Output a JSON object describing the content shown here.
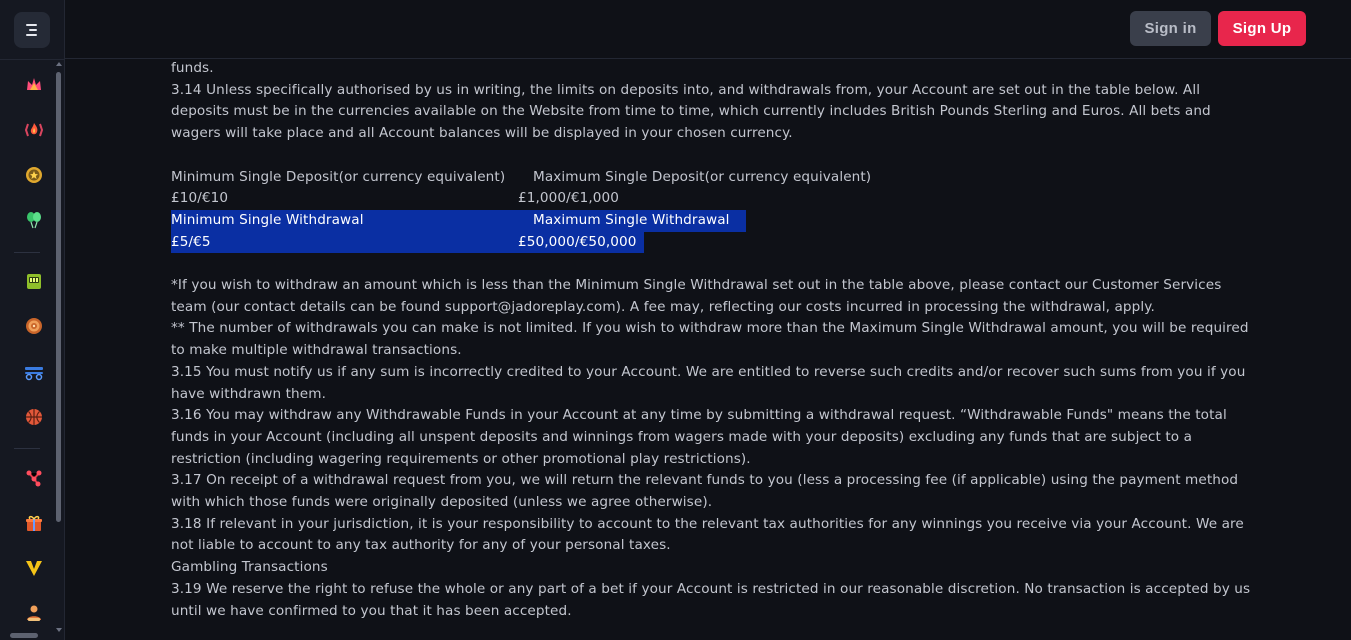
{
  "header": {
    "signin_label": "Sign in",
    "signup_label": "Sign Up",
    "signup_color": "#e8264c"
  },
  "sidebar": {
    "menu_icon": "menu-icon",
    "icons": [
      "flame-crown-icon",
      "fire-badge-icon",
      "star-coin-icon",
      "balloons-icon",
      "slot-machine-icon",
      "target-icon",
      "table-games-icon",
      "basketball-icon",
      "molecule-icon",
      "gift-box-icon",
      "v-logo-icon",
      "users-icon"
    ]
  },
  "content": {
    "line_funds": "funds.",
    "para_314": "3.14 Unless specifically authorised by us in writing, the limits on deposits into, and withdrawals from, your Account are set out in the table below. All deposits must be in the currencies available on the Website from time to time, which currently includes British Pounds Sterling and Euros. All bets and wagers will take place and all Account balances will be displayed in your chosen currency.",
    "table": {
      "min_deposit_label": "Minimum Single Deposit(or currency equivalent)",
      "max_deposit_label": "Maximum Single Deposit(or currency equivalent)",
      "min_deposit_value": "£10/€10",
      "max_deposit_value": "£1,000/€1,000",
      "min_withdrawal_label": "Minimum Single Withdrawal",
      "max_withdrawal_label": "Maximum Single Withdrawal",
      "min_withdrawal_value": "£5/€5",
      "max_withdrawal_value": "£50,000/€50,000"
    },
    "note_1": "*If you wish to withdraw an amount which is less than the Minimum Single Withdrawal set out in the table above, please contact our Customer Services team (our contact details can be found support@jadoreplay.com). A fee may, reflecting our costs incurred in processing the withdrawal, apply.",
    "note_2": "** The number of withdrawals you can make is not limited. If you wish to withdraw more than the Maximum Single Withdrawal amount, you will be required to make multiple withdrawal transactions.",
    "para_315": "3.15 You must notify us if any sum is incorrectly credited to your Account. We are entitled to reverse such credits and/or recover such sums from you if you have withdrawn them.",
    "para_316": "3.16 You may withdraw any Withdrawable Funds in your Account at any time by submitting a withdrawal request. “Withdrawable Funds\" means the total funds in your Account (including all unspent deposits and winnings from wagers made with your deposits) excluding any funds that are subject to a restriction (including wagering requirements or other promotional play restrictions).",
    "para_317": "3.17 On receipt of a withdrawal request from you, we will return the relevant funds to you (less a processing fee (if applicable) using the payment method with which those funds were originally deposited (unless we agree otherwise).",
    "para_318": "3.18 If relevant in your jurisdiction, it is your responsibility to account to the relevant tax authorities for any winnings you receive via your Account. We are not liable to account to any tax authority for any of your personal taxes.",
    "heading_gambling": "Gambling Transactions",
    "para_319": "3.19 We reserve the right to refuse the whole or any part of a bet if your Account is restricted in our reasonable discretion. No transaction is accepted by us until we have confirmed to you that it has been accepted."
  }
}
